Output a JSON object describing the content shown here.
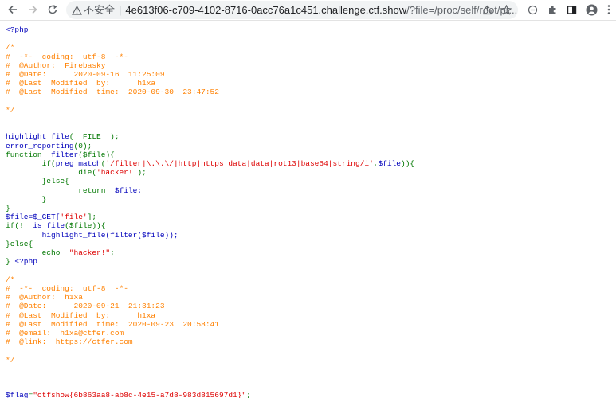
{
  "browser": {
    "security_label": "不安全",
    "separator": "|",
    "url_host": "4e613f06-c709-4102-8716-0acc76a1c451.challenge.ctf.show",
    "url_path": "/?file=/proc/self/root/pr..."
  },
  "code": {
    "php_open": "<?php",
    "header_comment": "/*\n#  -*-  coding:  utf-8  -*-\n#  @Author:  Firebasky\n#  @Date:      2020-09-16  11:25:09\n#  @Last  Modified  by:      h1xa\n#  @Last  Modified  time:  2020-09-30  23:47:52\n\n*/",
    "highlight_file_call": "highlight_file",
    "file_const": "(__FILE__);",
    "error_reporting_call": "error_reporting",
    "error_reporting_args": "(0);",
    "function_kw": "function",
    "filter_name": "filter",
    "filter_param": "($file){",
    "if_kw": "if(",
    "preg_match_name": "preg_match",
    "paren_open": "(",
    "regex": "'/filter|\\.\\.\\/|http|https|data|data|rot13|base64|string/i'",
    "comma": ",",
    "file_var": "$file",
    "close_if": ")){",
    "die_name": "die",
    "die_msg": "'hacker!'",
    "die_end": ");",
    "else_block": "}else{",
    "return_kw": "return",
    "return_val": "$file;",
    "brace_close_inner": "}",
    "brace_close_fn": "}",
    "get_assign": "$file=$_GET[",
    "get_key": "'file'",
    "get_end": "];",
    "if_not": "if(!",
    "is_file_call": "is_file",
    "is_file_args": "($file)){",
    "highlight_filter_call": "highlight_file(filter($file));",
    "else_line": "}else{",
    "echo_kw": "echo",
    "echo_msg": "\"hacker!\"",
    "echo_end": ";",
    "final_close": "}",
    "php_reopen": "<?php",
    "second_comment": "/*\n#  -*-  coding:  utf-8  -*-\n#  @Author:  h1xa\n#  @Date:      2020-09-21  21:31:23\n#  @Last  Modified  by:      h1xa\n#  @Last  Modified  time:  2020-09-23  20:58:41\n#  @email:  h1xa@ctfer.com\n#  @link:  https://ctfer.com\n\n*/",
    "flag_var": "$flag",
    "flag_eq": "=",
    "flag_value": "\"ctfshow{6b863aa8-ab8c-4e15-a7d8-983d815697d1}\"",
    "flag_end": ";"
  },
  "icons": {
    "back": "arrow-left",
    "forward": "arrow-right",
    "reload": "refresh",
    "warning": "warning-triangle",
    "share": "share",
    "bookmark": "star",
    "pause": "circle-dash",
    "extensions": "puzzle",
    "sidebar": "side-panel",
    "profile": "person"
  }
}
